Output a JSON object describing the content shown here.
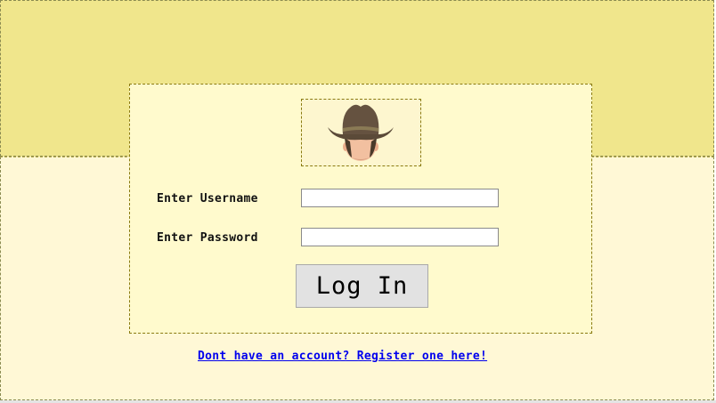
{
  "login": {
    "username_label": "Enter Username",
    "password_label": "Enter Password",
    "username_value": "",
    "password_value": "",
    "login_button": "Log In",
    "register_link": "Dont have an account? Register one here!"
  },
  "avatar": {
    "icon": "cowboy-avatar-icon"
  },
  "colors": {
    "header_band": "#f0e68c",
    "body_band": "#fff8d6",
    "panel": "#fffacd",
    "button": "#e2e2e2",
    "link": "#0000ee"
  }
}
